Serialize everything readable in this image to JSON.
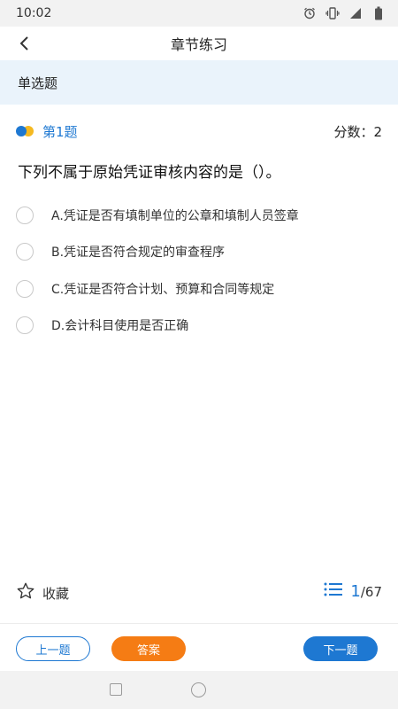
{
  "status_bar": {
    "time": "10:02",
    "icons": [
      "alarm-icon",
      "vibrate-icon",
      "signal-icon",
      "battery-icon"
    ]
  },
  "nav": {
    "title": "章节练习",
    "back_icon": "back-arrow-icon"
  },
  "section": {
    "label": "单选题"
  },
  "question": {
    "number_label": "第1题",
    "score_label": "分数：2",
    "text": "下列不属于原始凭证审核内容的是（）。",
    "options": [
      {
        "label": "A.凭证是否有填制单位的公章和填制人员签章"
      },
      {
        "label": "B.凭证是否符合规定的审查程序"
      },
      {
        "label": "C.凭证是否符合计划、预算和合同等规定"
      },
      {
        "label": "D.会计科目使用是否正确"
      }
    ]
  },
  "footer_info": {
    "favorite_label": "收藏",
    "current": "1",
    "total": "/67"
  },
  "buttons": {
    "prev_label": "上一题",
    "answer_label": "答案",
    "next_label": "下一题"
  },
  "colors": {
    "accent": "#1e78d2",
    "answer_button": "#f57c14",
    "section_bg": "#eaf3fb",
    "dot_yellow": "#f5b921"
  }
}
